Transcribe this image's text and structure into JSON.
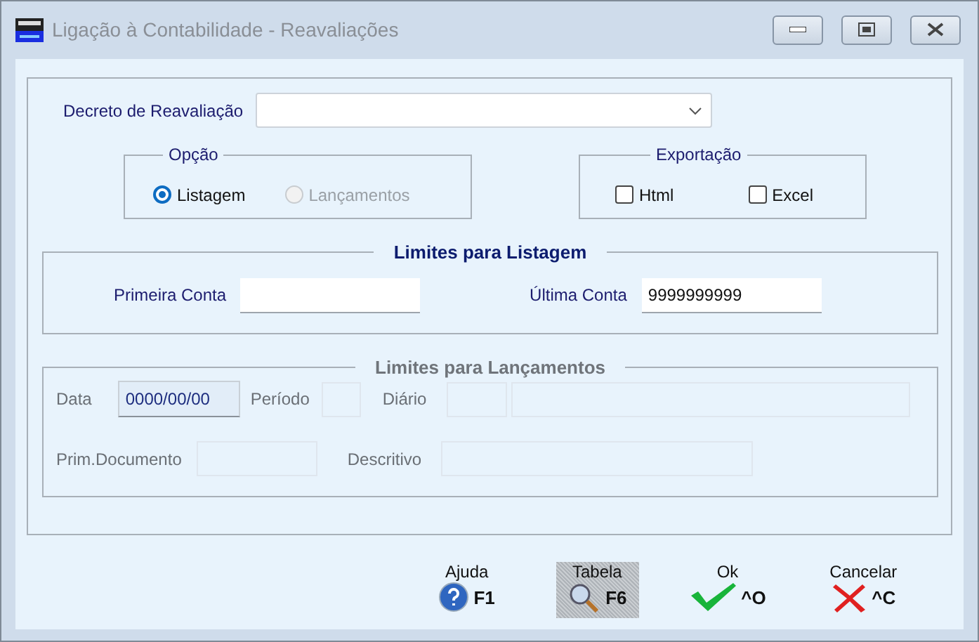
{
  "window": {
    "title": "Ligação à Contabilidade - Reavaliações"
  },
  "decreto": {
    "label": "Decreto de Reavaliação"
  },
  "opcao": {
    "title": "Opção",
    "options": [
      {
        "label": "Listagem",
        "selected": true,
        "disabled": false
      },
      {
        "label": "Lançamentos",
        "selected": false,
        "disabled": true
      }
    ]
  },
  "exportacao": {
    "title": "Exportação",
    "options": [
      {
        "label": "Html",
        "checked": false
      },
      {
        "label": "Excel",
        "checked": false
      }
    ]
  },
  "limites_listagem": {
    "title": "Limites para Listagem",
    "fields": [
      {
        "label": "Primeira Conta"
      },
      {
        "label": "Última Conta",
        "value": "9999999999"
      }
    ]
  },
  "limites_lancamentos": {
    "title": "Limites para Lançamentos",
    "disabled": true,
    "data": {
      "label": "Data",
      "value": "0000/00/00"
    },
    "periodo": {
      "label": "Período"
    },
    "diario": {
      "label": "Diário"
    },
    "prim_documento": {
      "label": "Prim.Documento"
    },
    "descritivo": {
      "label": "Descritivo"
    }
  },
  "buttons": [
    {
      "label": "Ajuda",
      "key": "F1",
      "kind": "help",
      "disabled": false
    },
    {
      "label": "Tabela",
      "key": "F6",
      "kind": "table",
      "disabled": true
    },
    {
      "label": "Ok",
      "key": "^O",
      "kind": "ok",
      "disabled": false
    },
    {
      "label": "Cancelar",
      "key": "^C",
      "kind": "cancel",
      "disabled": false
    }
  ]
}
